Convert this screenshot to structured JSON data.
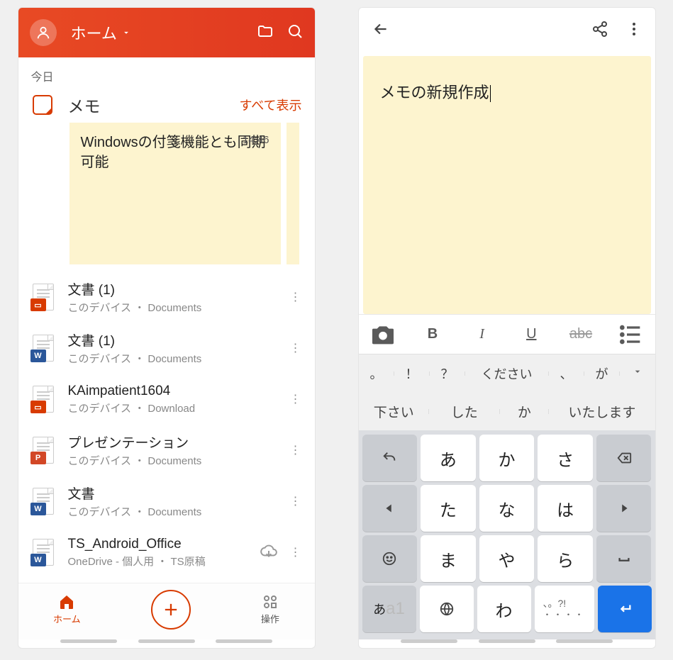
{
  "left": {
    "header": {
      "title": "ホーム"
    },
    "date_label": "今日",
    "memo": {
      "title": "メモ",
      "show_all": "すべて表示",
      "sticky_text": "Windowsの付箋機能とも同期可能",
      "sticky_time": "14:46"
    },
    "files": [
      {
        "name": "文書 (1)",
        "loc": "このデバイス ・ Documents",
        "type": "office"
      },
      {
        "name": "文書 (1)",
        "loc": "このデバイス ・ Documents",
        "type": "word"
      },
      {
        "name": "KAimpatient1604",
        "loc": "このデバイス ・ Download",
        "type": "office"
      },
      {
        "name": "プレゼンテーション",
        "loc": "このデバイス ・ Documents",
        "type": "ppt"
      },
      {
        "name": "文書",
        "loc": "このデバイス ・ Documents",
        "type": "word"
      },
      {
        "name": "TS_Android_Office",
        "loc": "OneDrive - 個人用 ・ TS原稿",
        "type": "word",
        "cloud": true
      }
    ],
    "nav": {
      "home": "ホーム",
      "actions": "操作"
    }
  },
  "right": {
    "note_text": "メモの新規作成",
    "suggest1": [
      "。",
      "！",
      "？",
      "ください",
      "、",
      "が"
    ],
    "suggest2": [
      "下さい",
      "した",
      "か",
      "いたします"
    ],
    "kana": {
      "r1": [
        "あ",
        "か",
        "さ"
      ],
      "r2": [
        "た",
        "な",
        "は"
      ],
      "r3": [
        "ま",
        "や",
        "ら"
      ],
      "r4": [
        "わ"
      ]
    },
    "mode": {
      "a": "あ",
      "b": "a1"
    }
  }
}
